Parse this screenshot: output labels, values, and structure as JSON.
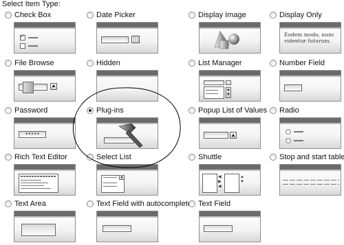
{
  "heading": "Select Item Type:",
  "items": [
    {
      "label": "Check Box",
      "selected": false,
      "icon": "check-box-thumbnail"
    },
    {
      "label": "Date Picker",
      "selected": false,
      "icon": "date-picker-thumbnail"
    },
    {
      "label": "Display Image",
      "selected": false,
      "icon": "display-image-thumbnail"
    },
    {
      "label": "Display Only",
      "selected": false,
      "icon": "display-only-thumbnail",
      "sample_text": [
        "Eodem modo, nunc",
        "videntur futurum."
      ]
    },
    {
      "label": "File Browse",
      "selected": false,
      "icon": "file-browse-thumbnail"
    },
    {
      "label": "Hidden",
      "selected": false,
      "icon": "hidden-thumbnail"
    },
    {
      "label": "List Manager",
      "selected": false,
      "icon": "list-manager-thumbnail"
    },
    {
      "label": "Number Field",
      "selected": false,
      "icon": "number-field-thumbnail"
    },
    {
      "label": "Password",
      "selected": false,
      "icon": "password-thumbnail",
      "mask": "*****"
    },
    {
      "label": "Plug-ins",
      "selected": true,
      "icon": "plug-ins-hammer-thumbnail"
    },
    {
      "label": "Popup List of Values",
      "selected": false,
      "icon": "popup-lov-thumbnail"
    },
    {
      "label": "Radio",
      "selected": false,
      "icon": "radio-thumbnail"
    },
    {
      "label": "Rich Text Editor",
      "selected": false,
      "icon": "rich-text-editor-thumbnail"
    },
    {
      "label": "Select List",
      "selected": false,
      "icon": "select-list-thumbnail"
    },
    {
      "label": "Shuttle",
      "selected": false,
      "icon": "shuttle-thumbnail"
    },
    {
      "label": "Stop and start table",
      "selected": false,
      "icon": "stop-start-table-thumbnail"
    },
    {
      "label": "Text Area",
      "selected": false,
      "icon": "text-area-thumbnail"
    },
    {
      "label": "Text Field with autocomplete",
      "selected": false,
      "icon": "text-field-autocomplete-thumbnail"
    },
    {
      "label": "Text Field",
      "selected": false,
      "icon": "text-field-thumbnail"
    }
  ],
  "annotation": {
    "shape": "hand-drawn ellipse",
    "color": "#000000",
    "target": "Plug-ins"
  }
}
